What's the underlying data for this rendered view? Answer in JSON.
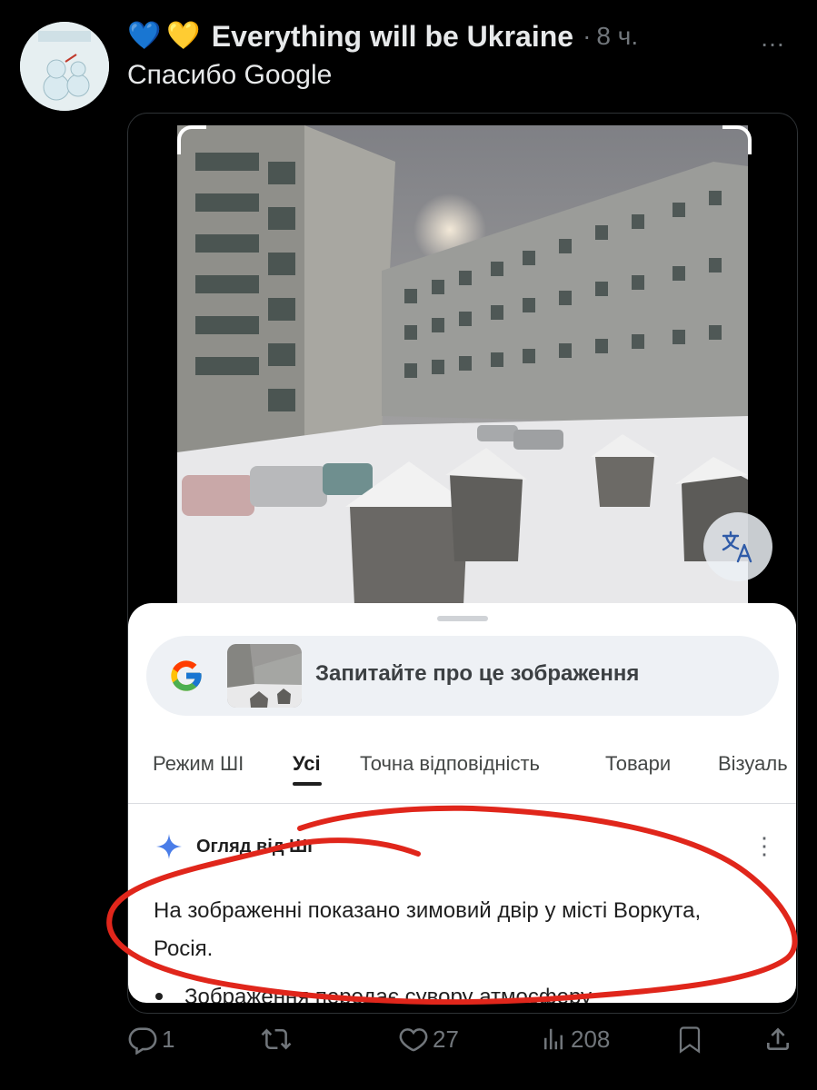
{
  "tweet": {
    "emoji_1": "💙",
    "emoji_2": "💛",
    "display_name": "Everything will be Ukraine",
    "separator": "·",
    "time_ago": "8 ч.",
    "more_icon": "…",
    "text": "Спасибо Google"
  },
  "google_lens": {
    "search_placeholder": "Запитайте про це зображення",
    "tabs": [
      {
        "label": "Режим ШІ",
        "active": false
      },
      {
        "label": "Усі",
        "active": true
      },
      {
        "label": "Точна відповідність",
        "active": false
      },
      {
        "label": "Товари",
        "active": false
      },
      {
        "label": "Візуаль",
        "active": false
      }
    ],
    "ai_overview_title": "Огляд від ШІ",
    "ai_answer": "На зображенні показано зимовий двір у місті Воркута, Росія.",
    "bullet_text": "Зображення передає сувору атмосферу"
  },
  "actions": {
    "replies": "1",
    "reposts": "",
    "likes": "27",
    "views": "208"
  },
  "colors": {
    "background": "#000000",
    "muted": "#71767b",
    "annotation_red": "#e0261b"
  }
}
